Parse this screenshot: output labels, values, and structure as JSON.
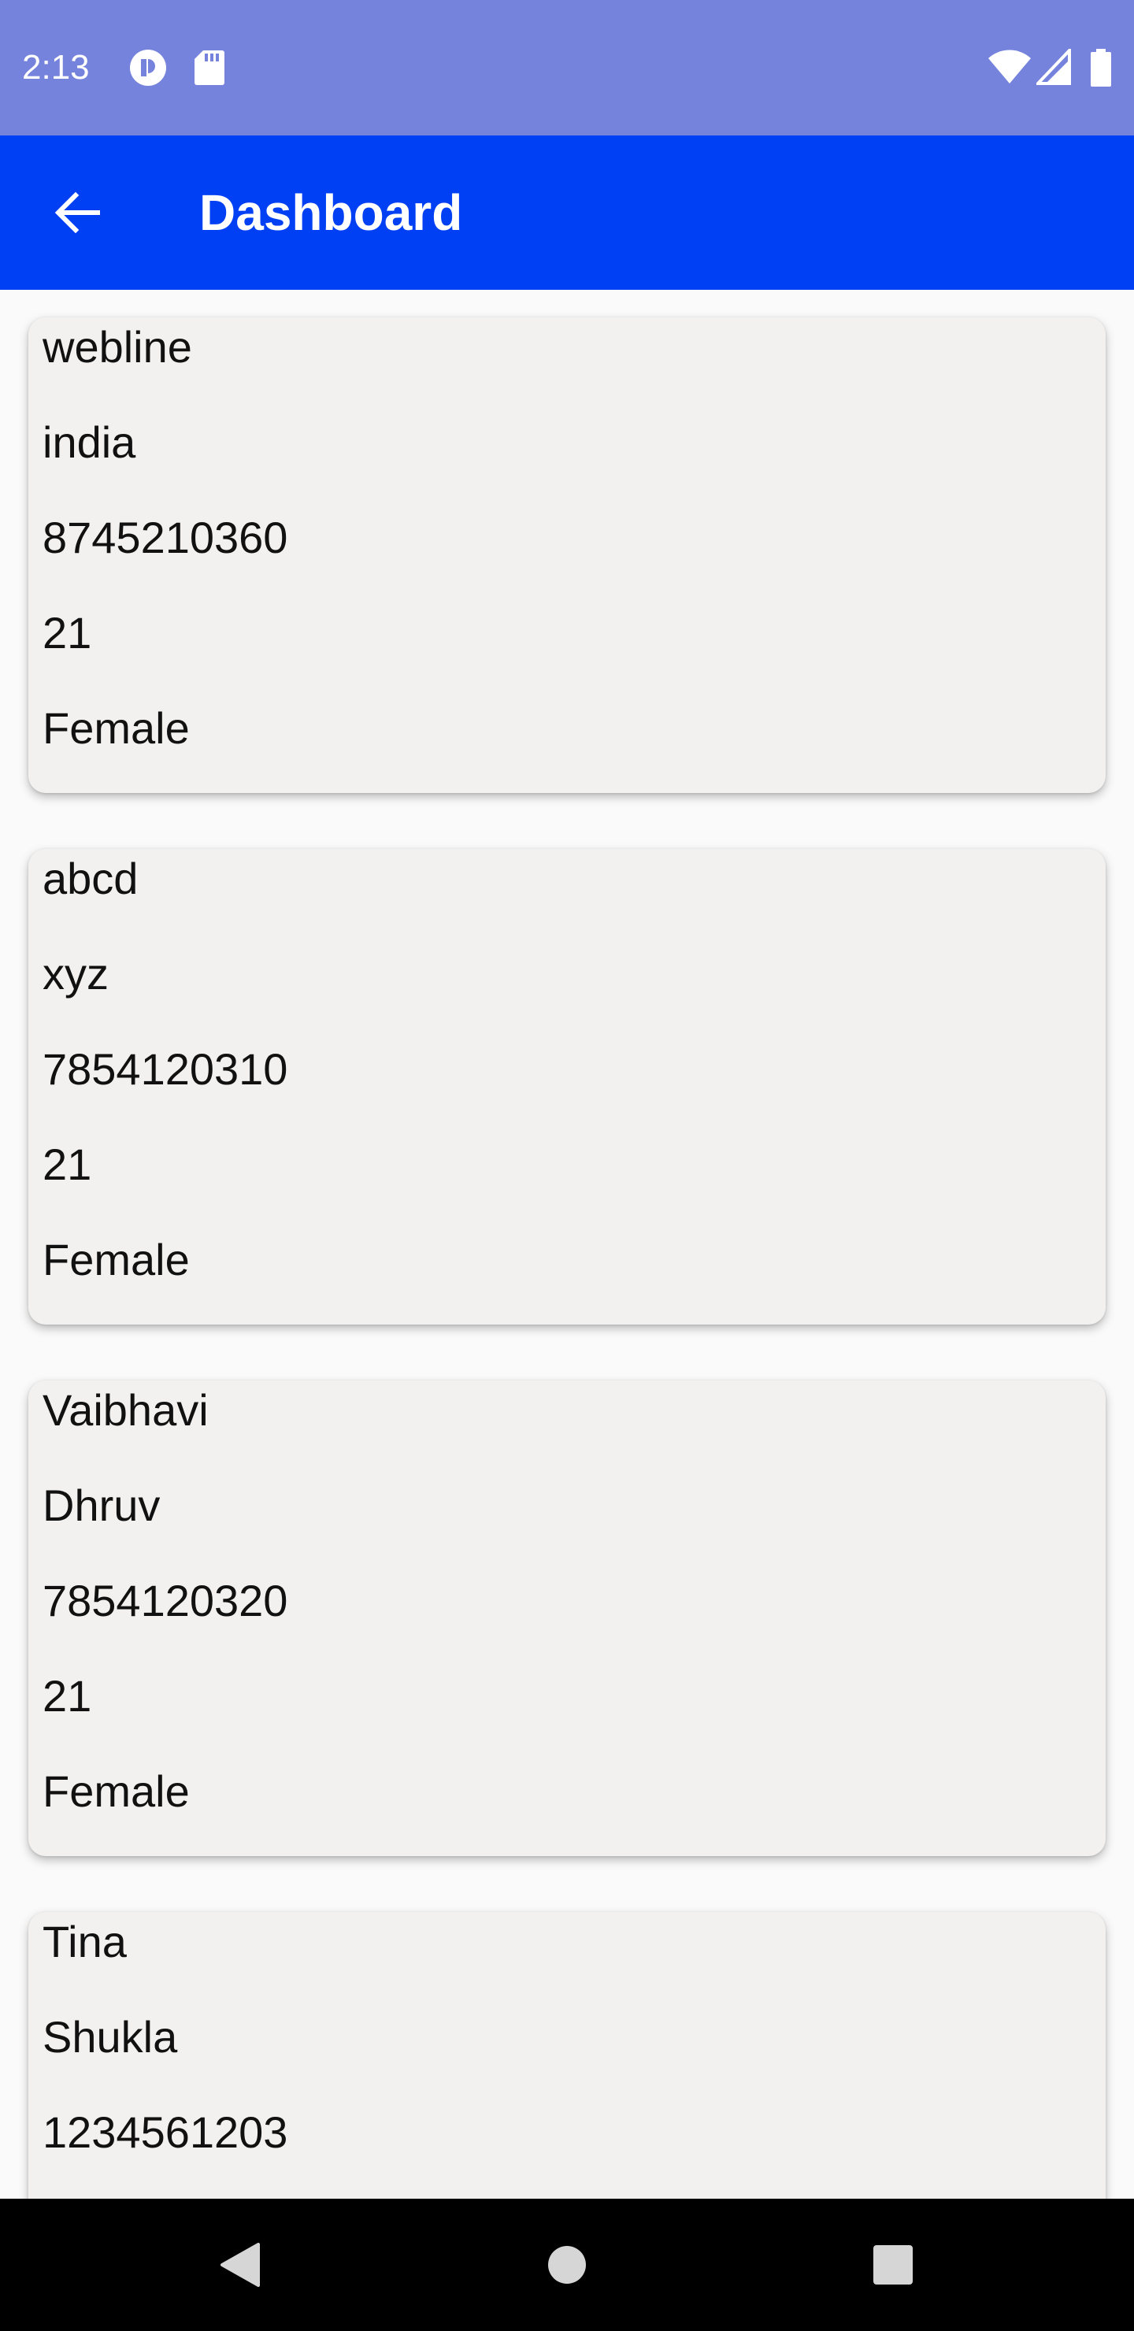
{
  "status_bar": {
    "time": "2:13",
    "left_icons": [
      "podcast-app-icon",
      "sd-card-icon"
    ],
    "right_icons": [
      "wifi-icon",
      "cell-signal-icon",
      "battery-icon"
    ],
    "background": "#7683dc"
  },
  "app_bar": {
    "title": "Dashboard",
    "back_icon": "arrow-back-icon",
    "background": "#0040f5"
  },
  "cards": [
    {
      "name": "webline",
      "surname": "india",
      "phone": "8745210360",
      "age": "21",
      "gender": "Female"
    },
    {
      "name": "abcd",
      "surname": "xyz",
      "phone": "7854120310",
      "age": "21",
      "gender": "Female"
    },
    {
      "name": "Vaibhavi",
      "surname": "Dhruv",
      "phone": "7854120320",
      "age": "21",
      "gender": "Female"
    },
    {
      "name": "Tina",
      "surname": "Shukla",
      "phone": "1234561203",
      "age": "",
      "gender": ""
    }
  ],
  "nav_bar": {
    "icons": [
      "back-triangle-icon",
      "home-circle-icon",
      "recents-square-icon"
    ]
  }
}
